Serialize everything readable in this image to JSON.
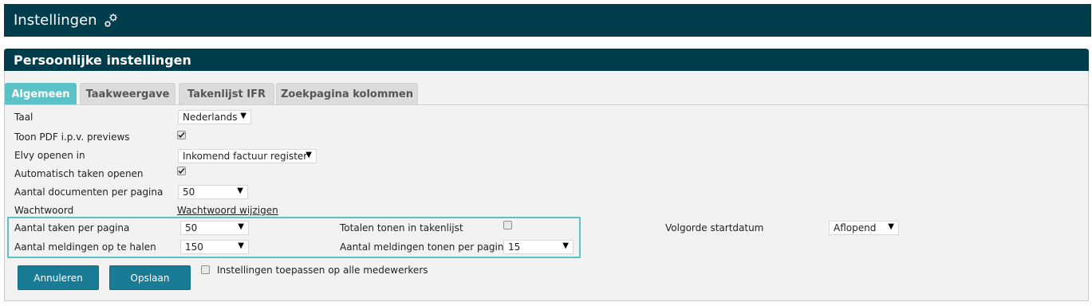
{
  "topbar": {
    "title": "Instellingen",
    "icon": "gears-icon"
  },
  "panel": {
    "title": "Persoonlijke instellingen"
  },
  "tabs": [
    {
      "label": "Algemeen",
      "active": true
    },
    {
      "label": "Taakweergave",
      "active": false
    },
    {
      "label": "Takenlijst IFR",
      "active": false
    },
    {
      "label": "Zoekpagina kolommen",
      "active": false
    }
  ],
  "fields": {
    "taal": {
      "label": "Taal",
      "value": "Nederlands"
    },
    "toon_pdf": {
      "label": "Toon PDF i.p.v. previews",
      "checked": true
    },
    "elvy": {
      "label": "Elvy openen in",
      "value": "Inkomend factuur register"
    },
    "auto_taken": {
      "label": "Automatisch taken openen",
      "checked": true
    },
    "aantal_docs": {
      "label": "Aantal documenten per pagina",
      "value": "50"
    },
    "wachtwoord": {
      "label": "Wachtwoord",
      "link": "Wachtwoord wijzigen"
    },
    "aantal_taken": {
      "label": "Aantal taken per pagina",
      "value": "50"
    },
    "totalen": {
      "label": "Totalen tonen in takenlijst",
      "checked": false
    },
    "volgorde": {
      "label": "Volgorde startdatum",
      "value": "Aflopend"
    },
    "meldingen_ophalen": {
      "label": "Aantal meldingen op te halen",
      "value": "150"
    },
    "meldingen_tonen": {
      "label": "Aantal meldingen tonen per pagina",
      "value": "15"
    }
  },
  "actions": {
    "cancel": "Annuleren",
    "save": "Opslaan",
    "apply_all": {
      "label": "Instellingen toepassen op alle medewerkers",
      "checked": false
    }
  },
  "colors": {
    "header": "#003d4c",
    "accent": "#5bc3c8",
    "button": "#1a7c94"
  }
}
